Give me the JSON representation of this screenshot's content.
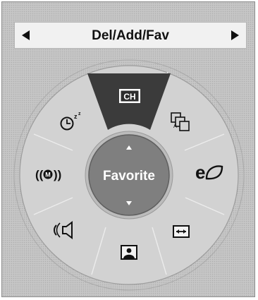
{
  "header": {
    "title": "Del/Add/Fav",
    "prev_icon": "arrow-left-icon",
    "next_icon": "arrow-right-icon"
  },
  "wheel": {
    "center_label": "Favorite",
    "center_up_icon": "arrow-up-icon",
    "center_down_icon": "arrow-down-icon",
    "selected_segment": "channel",
    "segments": [
      {
        "id": "channel",
        "icon": "ch-icon",
        "text": "CH"
      },
      {
        "id": "multi-language",
        "icon": "language-icon"
      },
      {
        "id": "eco",
        "icon": "eco-leaf-icon"
      },
      {
        "id": "picture-size",
        "icon": "aspect-ratio-icon"
      },
      {
        "id": "picture-mode",
        "icon": "picture-mode-icon"
      },
      {
        "id": "sound-mode",
        "icon": "speaker-icon"
      },
      {
        "id": "mts",
        "icon": "mts-icon"
      },
      {
        "id": "sleep-timer",
        "icon": "sleep-timer-icon"
      }
    ]
  },
  "colors": {
    "background": "#c6c6c6",
    "wheel_fill": "#d1d1d1",
    "selected_segment": "#3a3a3a",
    "center_button": "#7e7e7e",
    "center_text": "#ffffff"
  }
}
